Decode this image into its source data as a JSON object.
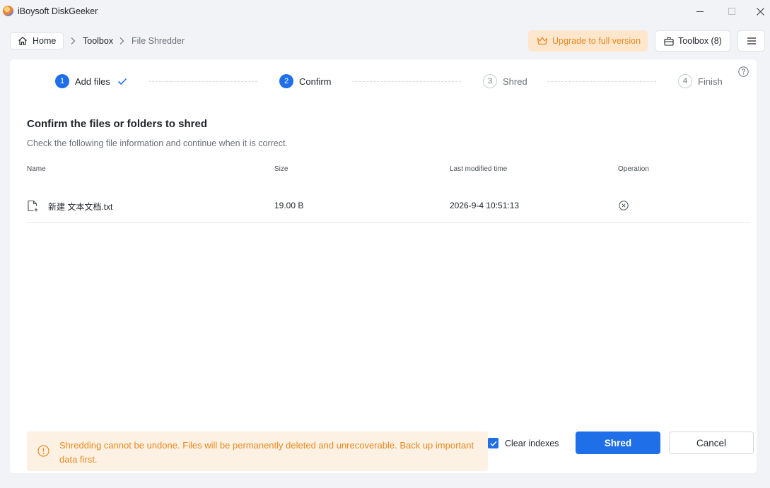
{
  "window": {
    "title": "iBoysoft DiskGeeker"
  },
  "nav": {
    "home_label": "Home",
    "breadcrumb": [
      "Toolbox",
      "File Shredder"
    ],
    "upgrade_label": "Upgrade to full version",
    "toolbox_label": "Toolbox (8)"
  },
  "steps": [
    {
      "num": "1",
      "label": "Add files",
      "state": "done"
    },
    {
      "num": "2",
      "label": "Confirm",
      "state": "active"
    },
    {
      "num": "3",
      "label": "Shred",
      "state": "pending"
    },
    {
      "num": "4",
      "label": "Finish",
      "state": "pending"
    }
  ],
  "main": {
    "heading": "Confirm the files or folders to shred",
    "subheading": "Check the following file information and continue when it is correct."
  },
  "table": {
    "columns": [
      "Name",
      "Size",
      "Last modified time",
      "Operation"
    ],
    "rows": [
      {
        "name": "新建 文本文档.txt",
        "size": "19.00 B",
        "modified": "2026-9-4 10:51:13"
      }
    ]
  },
  "footer": {
    "warning": "Shredding cannot be undone. Files will be permanently deleted and unrecoverable. Back up important data first.",
    "clear_indexes_label": "Clear indexes",
    "clear_indexes_checked": true,
    "shred_label": "Shred",
    "cancel_label": "Cancel"
  },
  "colors": {
    "accent": "#1f6fe8",
    "warning": "#e8891f",
    "warning_bg": "#fdf1e3",
    "upgrade_bg": "#fde6cc"
  }
}
